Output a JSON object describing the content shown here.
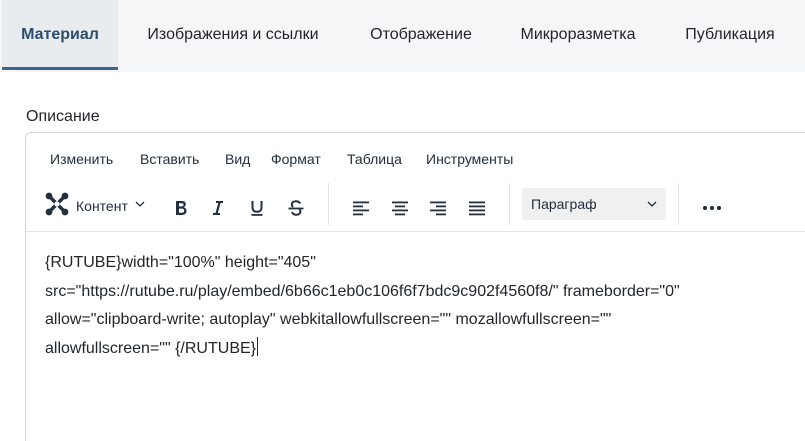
{
  "tabs": [
    {
      "label": "Материал",
      "active": true
    },
    {
      "label": "Изображения и ссылки"
    },
    {
      "label": "Отображение"
    },
    {
      "label": "Микроразметка"
    },
    {
      "label": "Публикация"
    }
  ],
  "field_label": "Описание",
  "menubar": [
    "Изменить",
    "Вставить",
    "Вид",
    "Формат",
    "Таблица",
    "Инструменты"
  ],
  "toolbar": {
    "content_label": "Контент",
    "content_icon": "joomla-icon",
    "bold": "bold-icon",
    "italic": "italic-icon",
    "underline": "underline-icon",
    "strikethrough": "strikethrough-icon",
    "align": [
      "align-left-icon",
      "align-center-icon",
      "align-right-icon",
      "align-justify-icon"
    ],
    "block_format": "Параграф",
    "more": "more-icon"
  },
  "content": {
    "lines": [
      "{RUTUBE}width=\"100%\" height=\"405\"",
      "src=\"https://rutube.ru/play/embed/6b66c1eb0c106f6f7bdc9c902f4560f8/\" frameborder=\"0\"",
      "allow=\"clipboard-write; autoplay\" webkitallowfullscreen=\"\" mozallowfullscreen=\"\"",
      "allowfullscreen=\"\" {/RUTUBE}"
    ]
  },
  "colors": {
    "accent": "#3a6590",
    "active_tab_text": "#2a4d6e",
    "tab_bar_bg": "#f5f6f7"
  }
}
